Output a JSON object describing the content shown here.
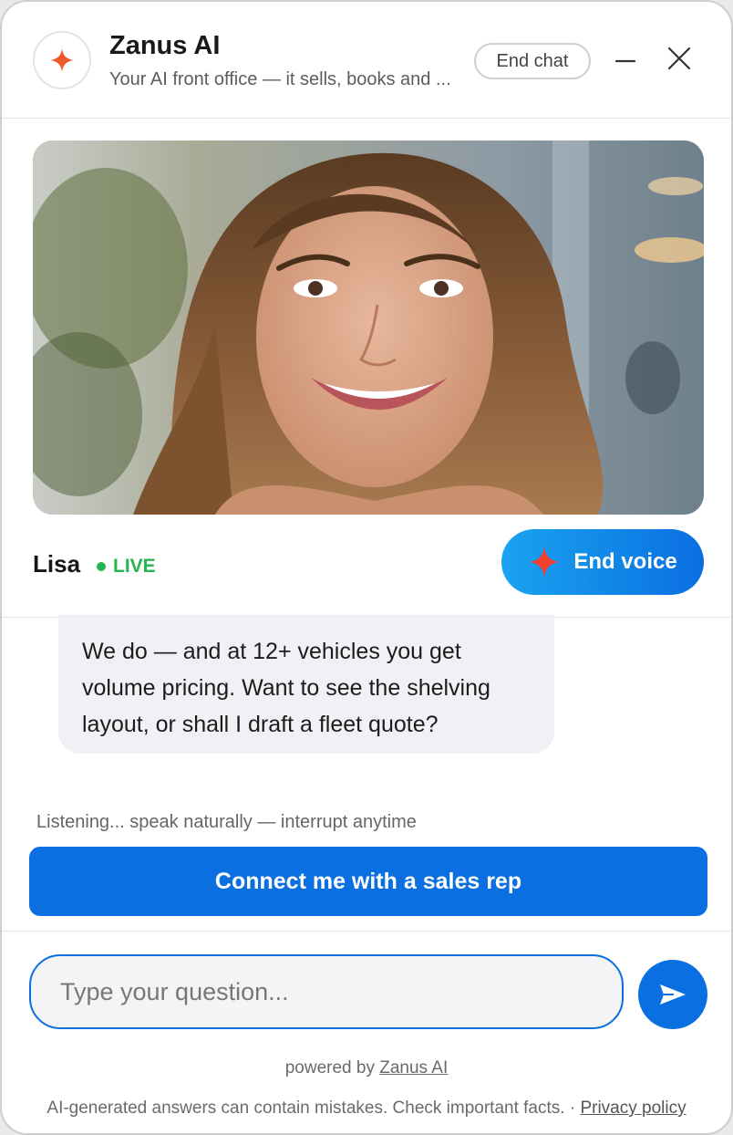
{
  "header": {
    "title": "Zanus AI",
    "subtitle": "Your AI front office — it sells, books and ...",
    "end_chat_label": "End chat",
    "logo_icon": "sparkle-icon",
    "accent_color": "#f25a2c"
  },
  "agent": {
    "name": "Lisa",
    "status": "LIVE",
    "end_voice_label": "End voice",
    "photo_icon": "agent-portrait"
  },
  "conversation": {
    "message": "We do — and at 12+ vehicles you get volume pricing. Want to see the shelving layout, or shall I draft a fleet quote?",
    "status_text": "Listening... speak naturally — interrupt anytime",
    "cta_label": "Connect me with a sales rep"
  },
  "composer": {
    "placeholder": "Type your question..."
  },
  "footer": {
    "powered_prefix": "powered by",
    "powered_link": "Zanus AI",
    "disclaimer": "AI-generated answers can contain mistakes. Check important facts. ·",
    "privacy_link": "Privacy policy"
  },
  "colors": {
    "primary": "#0a6fe0",
    "live": "#27b552",
    "bubble_bg": "#f1f1f5"
  }
}
